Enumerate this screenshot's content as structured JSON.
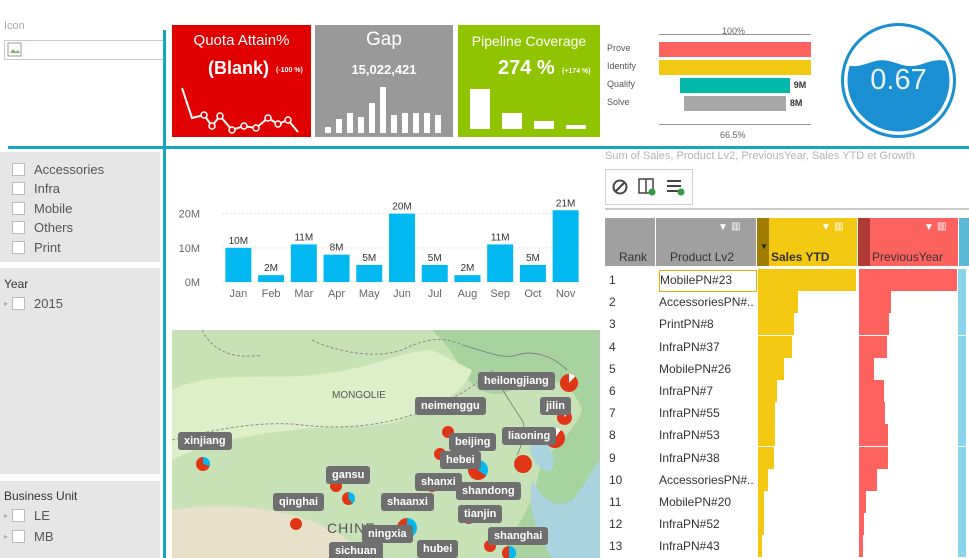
{
  "icon_panel": {
    "label": "Icon"
  },
  "kpis": {
    "quota": {
      "title": "Quota Attain%",
      "value": "(Blank)",
      "delta": "(-100 %)",
      "color": "#e00000"
    },
    "gap": {
      "title": "Gap",
      "value": "15,022,421",
      "color": "#999999"
    },
    "pipeline": {
      "title": "Pipeline Coverage",
      "value": "274 %",
      "delta": "(+174 %)",
      "color": "#8fc400"
    }
  },
  "funnel": {
    "top_label": "100%",
    "bottom_label": "66.5%",
    "stages": [
      {
        "name": "Prove",
        "color": "#fd625e",
        "fraction": 1.0,
        "value_label": ""
      },
      {
        "name": "Identify",
        "color": "#f2c811",
        "fraction": 1.0,
        "value_label": ""
      },
      {
        "name": "Qualify",
        "color": "#01b8aa",
        "fraction": 0.72,
        "value_label": "9M"
      },
      {
        "name": "Solve",
        "color": "#a8a8a8",
        "fraction": 0.67,
        "value_label": "8M"
      }
    ]
  },
  "gauge": {
    "value": "0.67",
    "fill_fraction": 0.67
  },
  "slicers": {
    "product": [
      "Accessories",
      "Infra",
      "Mobile",
      "Others",
      "Print"
    ],
    "year": {
      "title": "Year",
      "items": [
        "2015"
      ]
    },
    "business_unit": {
      "title": "Business Unit",
      "items": [
        "LE",
        "MB"
      ]
    }
  },
  "chart_data": {
    "type": "bar",
    "categories": [
      "Jan",
      "Feb",
      "Mar",
      "Apr",
      "May",
      "Jun",
      "Jul",
      "Aug",
      "Sep",
      "Oct",
      "Nov"
    ],
    "values": [
      10,
      2,
      11,
      8,
      5,
      20,
      5,
      2,
      11,
      5,
      21
    ],
    "data_labels": [
      "10M",
      "2M",
      "11M",
      "8M",
      "5M",
      "20M",
      "5M",
      "2M",
      "11M",
      "5M",
      "21M"
    ],
    "y_ticks": [
      "0M",
      "10M",
      "20M"
    ],
    "ylim": [
      0,
      24
    ],
    "color": "#01b8f0",
    "grid": true
  },
  "map": {
    "country_labels": [
      "MONGOLIE",
      "CHINE"
    ],
    "pins": [
      {
        "label": "heilongjiang"
      },
      {
        "label": "jilin"
      },
      {
        "label": "neimenggu"
      },
      {
        "label": "liaoning"
      },
      {
        "label": "beijing"
      },
      {
        "label": "xinjiang"
      },
      {
        "label": "hebei"
      },
      {
        "label": "gansu"
      },
      {
        "label": "shanxi"
      },
      {
        "label": "shandong"
      },
      {
        "label": "qinghai"
      },
      {
        "label": "shaanxi"
      },
      {
        "label": "tianjin"
      },
      {
        "label": "ningxia"
      },
      {
        "label": "shanghai"
      },
      {
        "label": "sichuan"
      },
      {
        "label": "hubei"
      }
    ]
  },
  "matrix": {
    "title": "Sum of Sales, Product Lv2, PreviousYear, Sales YTD et Growth",
    "columns": {
      "rank": "Rank",
      "product": "Product Lv2",
      "sales_ytd": "Sales YTD",
      "previous_year": "PreviousYear"
    },
    "rows": [
      {
        "rank": "1",
        "product": "MobilePN#23",
        "ytd": 1.0,
        "prev": 1.0
      },
      {
        "rank": "2",
        "product": "AccessoriesPN#...",
        "ytd": 0.41,
        "prev": 0.33
      },
      {
        "rank": "3",
        "product": "PrintPN#8",
        "ytd": 0.37,
        "prev": 0.31
      },
      {
        "rank": "4",
        "product": "InfraPN#37",
        "ytd": 0.35,
        "prev": 0.29
      },
      {
        "rank": "5",
        "product": "MobilePN#26",
        "ytd": 0.27,
        "prev": 0.15
      },
      {
        "rank": "6",
        "product": "InfraPN#7",
        "ytd": 0.19,
        "prev": 0.26
      },
      {
        "rank": "7",
        "product": "InfraPN#55",
        "ytd": 0.17,
        "prev": 0.27
      },
      {
        "rank": "8",
        "product": "InfraPN#53",
        "ytd": 0.17,
        "prev": 0.3
      },
      {
        "rank": "9",
        "product": "InfraPN#38",
        "ytd": 0.16,
        "prev": 0.3
      },
      {
        "rank": "10",
        "product": "AccessoriesPN#...",
        "ytd": 0.1,
        "prev": 0.18
      },
      {
        "rank": "11",
        "product": "MobilePN#20",
        "ytd": 0.06,
        "prev": 0.07
      },
      {
        "rank": "12",
        "product": "InfraPN#52",
        "ytd": 0.06,
        "prev": 0.05
      },
      {
        "rank": "13",
        "product": "InfraPN#43",
        "ytd": 0.04,
        "prev": 0.04
      }
    ]
  }
}
